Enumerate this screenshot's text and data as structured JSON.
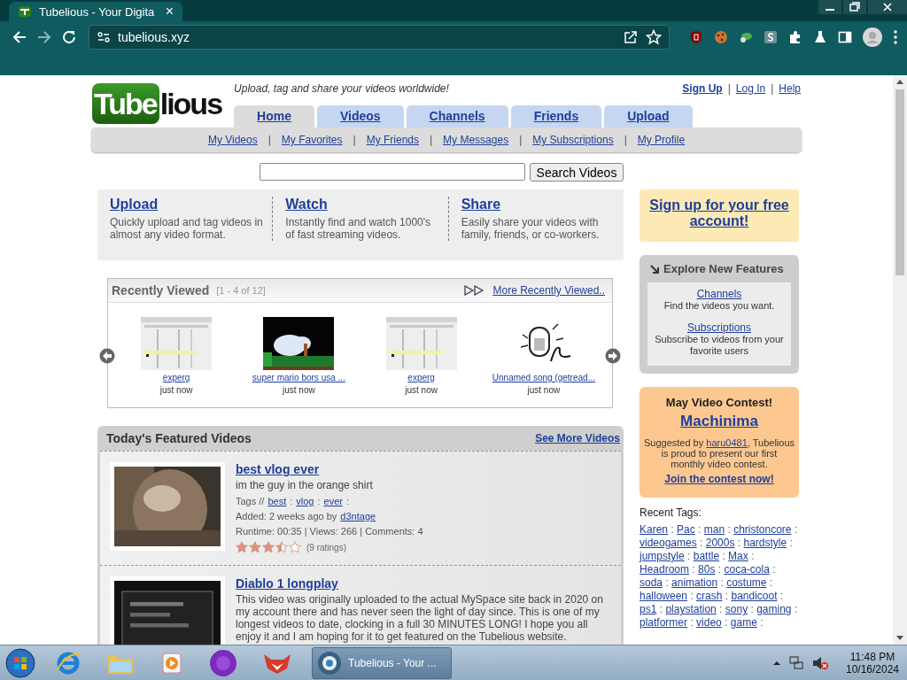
{
  "browser": {
    "tab": {
      "title": "Tubelious - Your Digita",
      "close": "×"
    },
    "address": "tubelious.xyz"
  },
  "header": {
    "logo": {
      "box": "Tube",
      "rest": "lious"
    },
    "tagline": "Upload, tag and share your videos worldwide!",
    "separator": "|",
    "account_links": [
      {
        "label": "Sign Up",
        "bold": true
      },
      {
        "label": "Log In",
        "bold": false
      },
      {
        "label": "Help",
        "bold": false
      }
    ]
  },
  "tabs": [
    {
      "label": "Home",
      "selected": true
    },
    {
      "label": "Videos",
      "selected": false
    },
    {
      "label": "Channels",
      "selected": false
    },
    {
      "label": "Friends",
      "selected": false
    },
    {
      "label": "Upload",
      "selected": false
    }
  ],
  "subnav": {
    "separator": "|",
    "items": [
      "My Videos",
      "My Favorites",
      "My Friends",
      "My Messages",
      "My Subscriptions",
      "My Profile"
    ]
  },
  "search": {
    "button": "Search Videos"
  },
  "intro": [
    {
      "title": "Upload",
      "text": "Quickly upload and tag videos in almost any video format."
    },
    {
      "title": "Watch",
      "text": "Instantly find and watch 1000's of fast streaming videos."
    },
    {
      "title": "Share",
      "text": "Easily share your videos with family, friends, or co-workers."
    }
  ],
  "recently_viewed": {
    "title": "Recently Viewed",
    "range": "[1 - 4 of 12]",
    "more": "More Recently Viewed..",
    "items": [
      {
        "title": "experg",
        "time": "just now",
        "kind": "picture"
      },
      {
        "title": "super mario bors usa ...",
        "time": "just now",
        "kind": "picture"
      },
      {
        "title": "experg",
        "time": "just now",
        "kind": "picture"
      },
      {
        "title": "Unnamed song (getread...",
        "time": "just now",
        "kind": "picture"
      }
    ]
  },
  "featured": {
    "title": "Today's Featured Videos",
    "more": "See More Videos",
    "videos": [
      {
        "title": "best vlog ever",
        "description": "im the guy in the orange shirt",
        "tags_label": "Tags //",
        "separator": ":",
        "tags": [
          "best",
          "vlog",
          "ever"
        ],
        "added": "Added: 2 weeks ago by",
        "author": "d3ntage",
        "stats": "Runtime: 00:35 | Views: 266 | Comments: 4",
        "stars": 3.5,
        "ratings": "(9 ratings)",
        "kind": "picture"
      },
      {
        "title": "Diablo 1 longplay",
        "description": "This video was originally uploaded to the actual MySpace site back in 2020 on my account there and has never seen the light of day since. This is one of my longest videos to date, clocking in a full 30 MINUTES LONG! I hope you all enjoy it and I am hoping for it to get featured on the Tubelious website.",
        "kind": "picture"
      }
    ]
  },
  "sidebar": {
    "signup": "Sign up for your free account!",
    "explore": {
      "title": "Explore New Features",
      "items": [
        {
          "link": "Channels",
          "text": "Find the videos you want."
        },
        {
          "link": "Subscriptions",
          "text": "Subscribe to videos from your favorite users"
        }
      ]
    },
    "contest": {
      "heading": "May Video Contest!",
      "title": "Machinima",
      "text_before": "Suggested by",
      "user": "haru0481",
      "text_after": ", Tubelious is proud to present our first monthly video contest.",
      "join": "Join the contest now!"
    },
    "recent_tags": {
      "label": "Recent Tags:",
      "separator": ":",
      "tags": [
        "Karen",
        "Pac",
        "man",
        "christoncore",
        "videogames",
        "2000s",
        "hardstyle",
        "jumpstyle",
        "battle",
        "Max",
        "Headroom",
        "80s",
        "coca-cola",
        "soda",
        "animation",
        "costume",
        "halloween",
        "crash",
        "bandicoot",
        "ps1",
        "playstation",
        "sony",
        "gaming",
        "platformer",
        "video",
        "game"
      ]
    }
  },
  "taskbar": {
    "window": "Tubelious - Your ...",
    "time": "11:48 PM",
    "date": "10/16/2024"
  }
}
